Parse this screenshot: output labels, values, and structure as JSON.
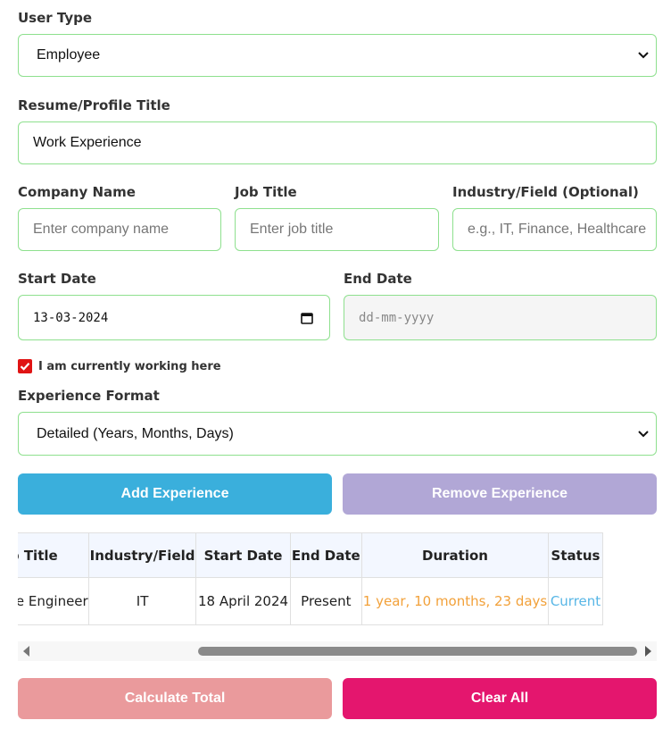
{
  "user_type": {
    "label": "User Type",
    "value": "Employee"
  },
  "resume_title": {
    "label": "Resume/Profile Title",
    "value": "Work Experience"
  },
  "company": {
    "label": "Company Name",
    "placeholder": "Enter company name"
  },
  "job_title": {
    "label": "Job Title",
    "placeholder": "Enter job title"
  },
  "industry": {
    "label": "Industry/Field (Optional)",
    "placeholder": "e.g., IT, Finance, Healthcare"
  },
  "start_date": {
    "label": "Start Date",
    "value": "13-03-2024"
  },
  "end_date": {
    "label": "End Date",
    "placeholder": "dd-mm-yyyy"
  },
  "current_checkbox": {
    "label": "I am currently working here",
    "checked": true
  },
  "experience_format": {
    "label": "Experience Format",
    "value": "Detailed (Years, Months, Days)"
  },
  "buttons": {
    "add": "Add Experience",
    "remove": "Remove Experience",
    "calculate": "Calculate Total",
    "clear": "Clear All"
  },
  "colors": {
    "field_border": "#8ee08e",
    "add_button": "#3aafdc",
    "remove_button": "#b1a7d6",
    "calculate_button": "#ea9a9c",
    "clear_button": "#e4166e",
    "duration_text": "#f2a13a",
    "status_text": "#57b6e6"
  },
  "table": {
    "headers": [
      "Job Title",
      "Industry/Field",
      "Start Date",
      "End Date",
      "Duration",
      "Status"
    ],
    "rows": [
      [
        "Software Engineer",
        "IT",
        "18 April 2024",
        "Present",
        "1 year, 10 months, 23 days",
        "Current"
      ]
    ]
  }
}
